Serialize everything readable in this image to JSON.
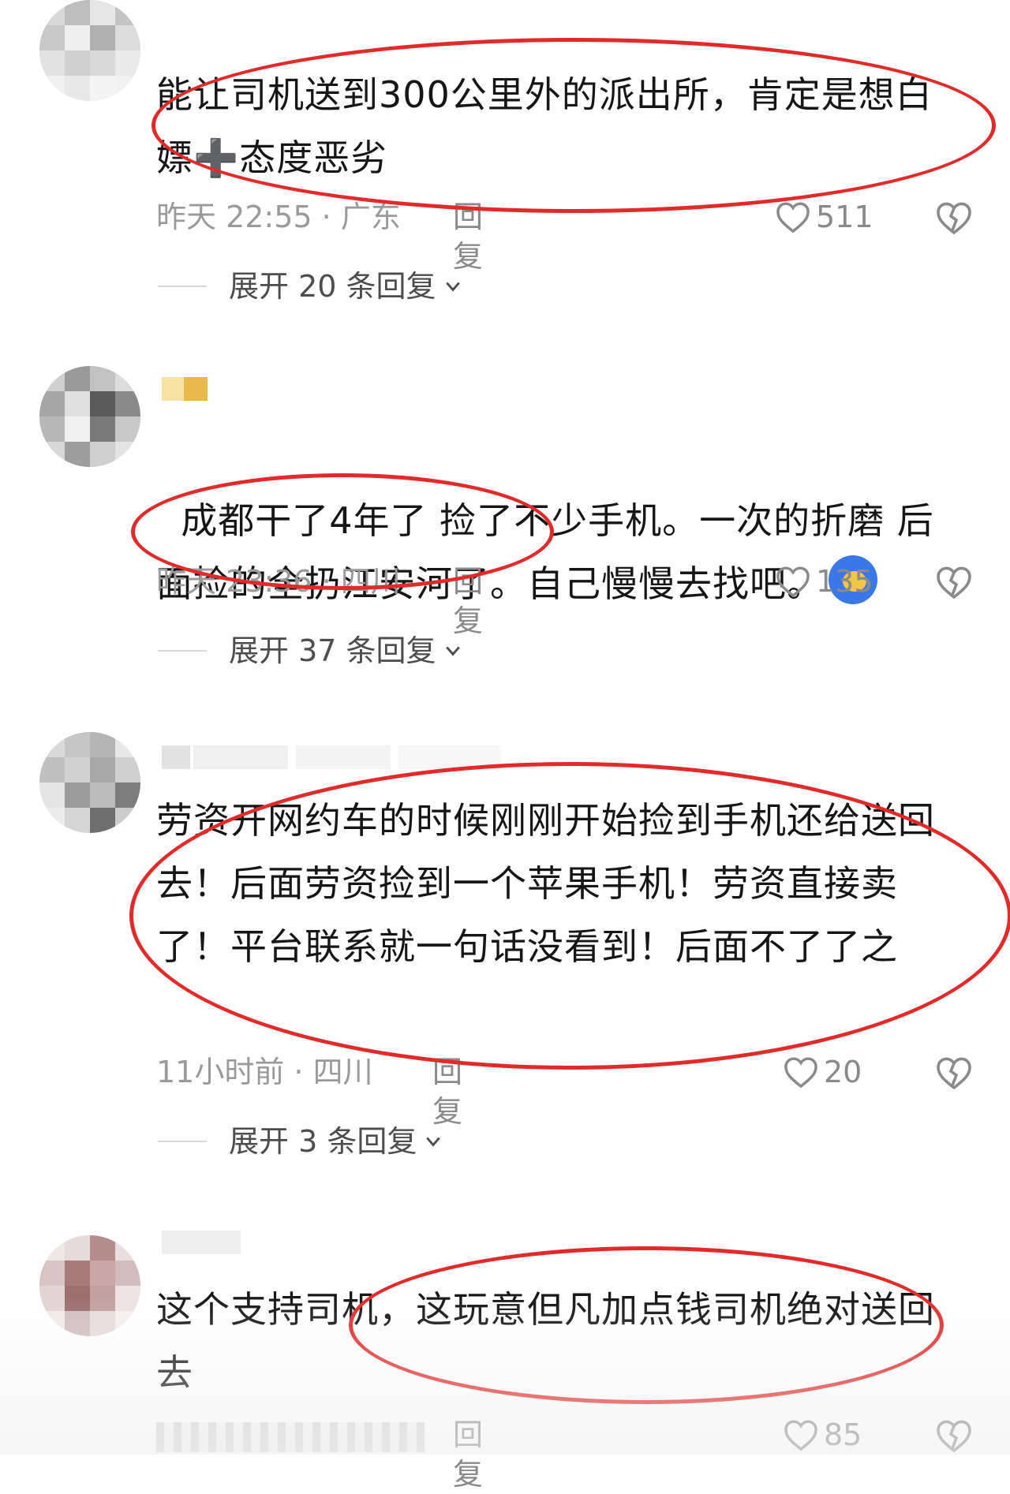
{
  "comments": [
    {
      "text": "能让司机送到300公里外的派出所，肯定是想白嫖➕态度恶劣",
      "meta": "昨天 22:55 · 广东",
      "reply_label": "回复",
      "likes": "511",
      "expand_label": "展开 20 条回复"
    },
    {
      "text": "成都干了4年了 捡了不少手机。一次的折磨 后面捡的全扔江安河了。自己慢慢去找吧。",
      "meta": "昨天 23:36 · 四川",
      "reply_label": "回复",
      "likes": "135",
      "expand_label": "展开 37 条回复"
    },
    {
      "text": "劳资开网约车的时候刚刚开始捡到手机还给送回去！后面劳资捡到一个苹果手机！劳资直接卖了！平台联系就一句话没看到！后面不了了之",
      "meta": "11小时前 · 四川",
      "reply_label": "回复",
      "likes": "20",
      "expand_label": "展开 3 条回复"
    },
    {
      "text": "这个支持司机，这玩意但凡加点钱司机绝对送回去",
      "meta": "",
      "reply_label": "回复",
      "likes": "85"
    }
  ],
  "colors": {
    "annotation": "#e32a2a",
    "muted": "#9a9a9a"
  },
  "icons": [
    "heart-icon",
    "broken-heart-icon",
    "chevron-down-icon"
  ]
}
